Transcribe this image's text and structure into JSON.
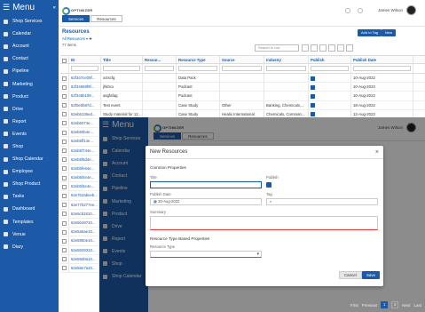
{
  "app": {
    "title": "Menu",
    "logo_text": "OPTIMIZER",
    "collapse_glyph": "«"
  },
  "sidebar": {
    "items": [
      {
        "label": "Shop Services"
      },
      {
        "label": "Calendar"
      },
      {
        "label": "Account"
      },
      {
        "label": "Contact"
      },
      {
        "label": "Pipeline"
      },
      {
        "label": "Marketing"
      },
      {
        "label": "Product"
      },
      {
        "label": "Drive"
      },
      {
        "label": "Report"
      },
      {
        "label": "Events"
      },
      {
        "label": "Shop"
      },
      {
        "label": "Shop Calendar"
      },
      {
        "label": "Employee"
      },
      {
        "label": "Shop Product"
      },
      {
        "label": "Tasks"
      },
      {
        "label": "Dashboard"
      },
      {
        "label": "Templates"
      },
      {
        "label": "Venue"
      },
      {
        "label": "Diary"
      }
    ]
  },
  "header": {
    "tabs": [
      "Services",
      "Resources"
    ],
    "active_tab": "Resources",
    "user_name": "James Wilson"
  },
  "resources": {
    "title": "Resources",
    "filter_label": "All Resources",
    "count_text": "77 items",
    "add_to_tag": "Add to Tag",
    "new_label": "New",
    "search_placeholder": "Search in List",
    "columns": [
      "ID",
      "Title",
      "Resour...",
      "Resource Type",
      "Source",
      "Industry",
      "Publish",
      "Publish Date"
    ],
    "rows": [
      {
        "id": "62f347ce09f...",
        "title": "xctscfg",
        "type": "Data Pack",
        "source": "",
        "industry": "",
        "publish": true,
        "date": "10-Aug-2022"
      },
      {
        "id": "62f34669f9f...",
        "title": "jhkhcx",
        "type": "Podcast",
        "source": "",
        "industry": "",
        "publish": true,
        "date": "10-Aug-2022"
      },
      {
        "id": "62f345b109...",
        "title": "asgfafag",
        "type": "Podcast",
        "source": "",
        "industry": "",
        "publish": true,
        "date": "10-Aug-2022"
      },
      {
        "id": "62f0e0b87d...",
        "title": "Test event",
        "type": "Case Study",
        "source": "Other",
        "industry": "Banking, Chemicals,...",
        "publish": true,
        "date": "18-Aug-2022"
      },
      {
        "id": "62eb6136ed...",
        "title": "Study material for 12...",
        "type": "Case Study",
        "source": "Healix International",
        "industry": "Chemicals, Comman...",
        "publish": true,
        "date": "12-Aug-2022"
      },
      {
        "id": "62eb6074e...",
        "title": "",
        "type": "",
        "source": "",
        "industry": "",
        "publish": false,
        "date": ""
      },
      {
        "id": "62eb60b4e...",
        "title": "",
        "type": "",
        "source": "",
        "industry": "",
        "publish": false,
        "date": ""
      },
      {
        "id": "62eb5ff14e...",
        "title": "",
        "type": "",
        "source": "",
        "industry": "",
        "publish": false,
        "date": ""
      },
      {
        "id": "62eb5f744e...",
        "title": "",
        "type": "",
        "source": "",
        "industry": "",
        "publish": false,
        "date": ""
      },
      {
        "id": "62eb5f5d4e...",
        "title": "",
        "type": "",
        "source": "",
        "industry": "",
        "publish": false,
        "date": ""
      },
      {
        "id": "62eb5fe64e...",
        "title": "",
        "type": "",
        "source": "",
        "industry": "",
        "publish": false,
        "date": ""
      },
      {
        "id": "62eb5f4e4e...",
        "title": "",
        "type": "",
        "source": "",
        "industry": "",
        "publish": false,
        "date": ""
      },
      {
        "id": "62eb5f4e4e...",
        "title": "",
        "type": "",
        "source": "",
        "industry": "",
        "publish": false,
        "date": ""
      },
      {
        "id": "62e7b2abeeb...",
        "title": "",
        "type": "",
        "source": "",
        "industry": "",
        "publish": false,
        "date": ""
      },
      {
        "id": "62e77b277ee...",
        "title": "",
        "type": "",
        "source": "",
        "industry": "",
        "publish": false,
        "date": ""
      },
      {
        "id": "62e5c51810...",
        "title": "",
        "type": "",
        "source": "",
        "industry": "",
        "publish": false,
        "date": ""
      },
      {
        "id": "62e5b49710...",
        "title": "",
        "type": "",
        "source": "",
        "industry": "",
        "publish": false,
        "date": ""
      },
      {
        "id": "62e5a6ae10...",
        "title": "",
        "type": "",
        "source": "",
        "industry": "",
        "publish": false,
        "date": ""
      },
      {
        "id": "62e5950e10...",
        "title": "",
        "type": "",
        "source": "",
        "industry": "",
        "publish": false,
        "date": ""
      },
      {
        "id": "62e5929310...",
        "title": "",
        "type": "",
        "source": "",
        "industry": "",
        "publish": false,
        "date": ""
      },
      {
        "id": "62e59d0a10...",
        "title": "",
        "type": "",
        "source": "",
        "industry": "",
        "publish": false,
        "date": ""
      },
      {
        "id": "62e58e7a10...",
        "title": "",
        "type": "",
        "source": "",
        "industry": "",
        "publish": false,
        "date": ""
      }
    ]
  },
  "modal": {
    "title": "New Resources",
    "common_props": "Common Properties",
    "title_label": "Title",
    "publish_label": "Publish",
    "publish_date_label": "Publish Date",
    "publish_date_value": "30-Aug-2022",
    "tag_label": "Tag",
    "summary_label": "Summary",
    "type_props": "Resource Type Based Properties",
    "resource_type_label": "Resource Type",
    "cancel": "Cancel",
    "save": "Save"
  },
  "pager": {
    "first": "First",
    "previous": "Previous",
    "pages": [
      "1",
      "2"
    ],
    "next": "Next",
    "last": "Last"
  },
  "colors": {
    "brand": "#1c5aa8",
    "required": "#e33333"
  }
}
